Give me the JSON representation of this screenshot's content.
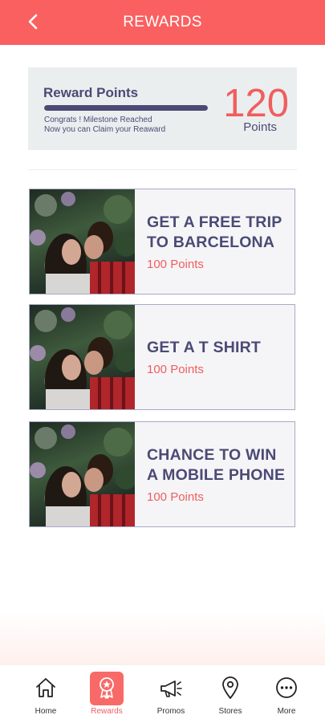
{
  "header": {
    "title": "REWARDS"
  },
  "points_card": {
    "title": "Reward Points",
    "progress_fraction": 1.0,
    "message_line1": "Congrats ! Milestone Reached",
    "message_line2": "Now you can Claim your Reaward",
    "value": "120",
    "unit": "Points"
  },
  "rewards": [
    {
      "title_line1": "GET A FREE TRIP",
      "title_line2": "TO BARCELONA",
      "points": "100 Points"
    },
    {
      "title_line1": "GET A T SHIRT",
      "title_line2": "",
      "points": "100 Points"
    },
    {
      "title_line1": "CHANCE TO WIN",
      "title_line2": "A MOBILE PHONE",
      "points": "100 Points"
    }
  ],
  "nav": [
    {
      "label": "Home",
      "icon": "home-icon"
    },
    {
      "label": "Rewards",
      "icon": "rewards-icon",
      "active": true
    },
    {
      "label": "Promos",
      "icon": "megaphone-icon"
    },
    {
      "label": "Stores",
      "icon": "location-pin-icon"
    },
    {
      "label": "More",
      "icon": "more-icon"
    }
  ],
  "colors": {
    "accent": "#fa6060",
    "primary_text": "#4b4a75"
  }
}
